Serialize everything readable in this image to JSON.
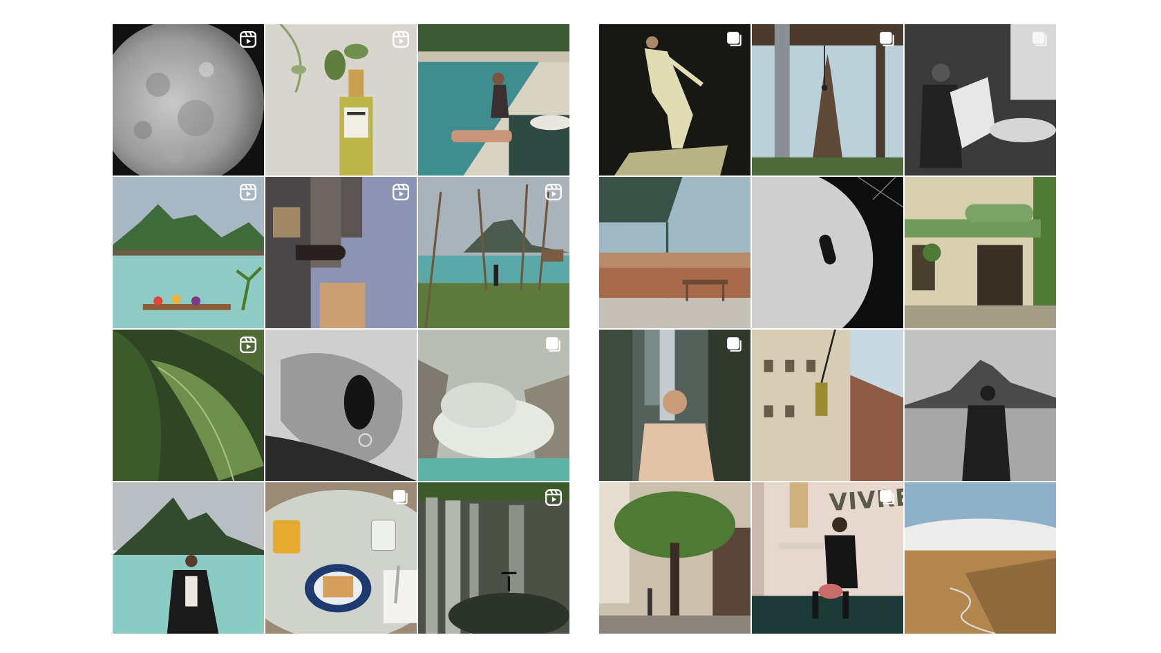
{
  "profile_grids": [
    {
      "name": "left-grid",
      "tiles": [
        {
          "subject": "moon",
          "badge": "reel-icon",
          "colors": [
            "#b8b8b8",
            "#1a1a1a"
          ]
        },
        {
          "subject": "perfume-bottle",
          "badge": "reel-icon",
          "colors": [
            "#d9d6cf",
            "#b4b049"
          ]
        },
        {
          "subject": "woman-by-pool",
          "badge": "none",
          "colors": [
            "#3f8d8f",
            "#2d3a2c"
          ]
        },
        {
          "subject": "lagoon-bungalows",
          "badge": "reel-icon",
          "colors": [
            "#8fc9c4",
            "#3f6a3a"
          ]
        },
        {
          "subject": "city-skyline-upside-down",
          "badge": "reel-icon",
          "colors": [
            "#8a8fb0",
            "#d9b37a"
          ]
        },
        {
          "subject": "palm-beach",
          "badge": "reel-icon",
          "colors": [
            "#5aa9a8",
            "#5c7a3c"
          ]
        },
        {
          "subject": "banana-leaves",
          "badge": "reel-icon",
          "colors": [
            "#3c5a2a",
            "#6f8f4c"
          ]
        },
        {
          "subject": "sunglasses-portrait",
          "badge": "none",
          "colors": [
            "#cfcfcf",
            "#1a1a1a"
          ]
        },
        {
          "subject": "volcanic-steam",
          "badge": "carousel-icon",
          "colors": [
            "#c9cfc7",
            "#5db3a4"
          ]
        },
        {
          "subject": "woman-at-lagoon",
          "badge": "none",
          "colors": [
            "#8ccac4",
            "#324a2d"
          ]
        },
        {
          "subject": "breakfast-table",
          "badge": "carousel-icon",
          "colors": [
            "#cfd3cc",
            "#e8a520"
          ]
        },
        {
          "subject": "waterfall",
          "badge": "reel-icon",
          "colors": [
            "#8c8f88",
            "#2c3328"
          ]
        }
      ]
    },
    {
      "name": "right-grid",
      "tiles": [
        {
          "subject": "dancer-shadow",
          "badge": "carousel-icon",
          "colors": [
            "#1a1a16",
            "#d8cf9c"
          ]
        },
        {
          "subject": "eiffel-tower",
          "badge": "carousel-icon",
          "colors": [
            "#b9cfd9",
            "#5f4a3a"
          ]
        },
        {
          "subject": "man-reading-newspaper",
          "badge": "carousel-icon",
          "colors": [
            "#3a3a3a",
            "#d9d9d9"
          ]
        },
        {
          "subject": "desert-shelter",
          "badge": "none",
          "colors": [
            "#9fb9c4",
            "#a76a4b"
          ]
        },
        {
          "subject": "abstract-bw",
          "badge": "none",
          "colors": [
            "#d2d2d2",
            "#0d0d0d"
          ]
        },
        {
          "subject": "cafe-le-sancerre",
          "badge": "none",
          "colors": [
            "#5f8a4b",
            "#d7cfb0"
          ]
        },
        {
          "subject": "man-in-city-street",
          "badge": "carousel-icon",
          "colors": [
            "#3e4a3d",
            "#e3c3a7"
          ]
        },
        {
          "subject": "building-traffic-light",
          "badge": "none",
          "colors": [
            "#d8ccb4",
            "#8c5a45"
          ]
        },
        {
          "subject": "silhouette-mountain",
          "badge": "none",
          "colors": [
            "#bdbdbd",
            "#1e1e1e"
          ]
        },
        {
          "subject": "street-tree",
          "badge": "none",
          "colors": [
            "#4f7a35",
            "#cbc0ad"
          ]
        },
        {
          "subject": "man-on-stool",
          "badge": "carousel-icon",
          "colors": [
            "#e6d7cf",
            "#1d3a36"
          ],
          "wall_text": "VIVRE"
        },
        {
          "subject": "clouds-valley",
          "badge": "none",
          "colors": [
            "#8fb0c9",
            "#b3864e"
          ]
        }
      ]
    }
  ]
}
